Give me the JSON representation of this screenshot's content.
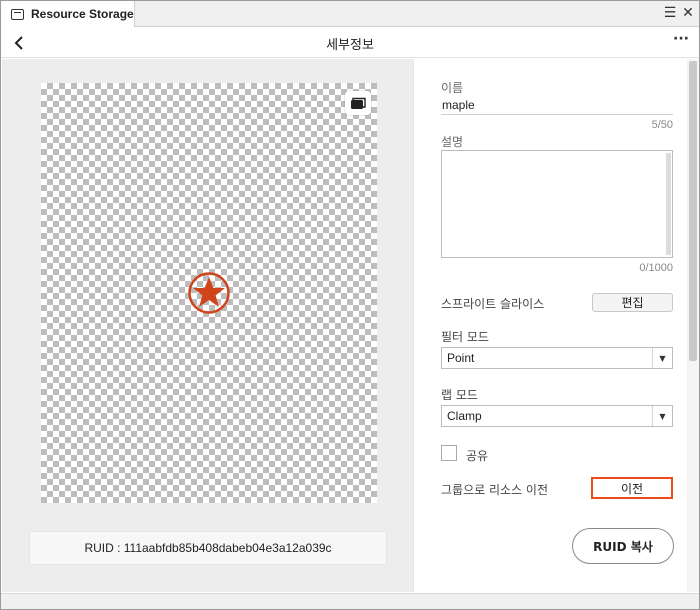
{
  "tab": {
    "label": "Resource Storage"
  },
  "window_controls": {
    "menu": "☰",
    "close": "✕"
  },
  "header": {
    "title": "세부정보",
    "more": "···"
  },
  "preview": {
    "ruid_text": "RUID : 111aabfdb85b408dabeb04e3a12a039c",
    "star_color": "#d0441c"
  },
  "details": {
    "name_label": "이름",
    "name_value": "maple",
    "name_counter": "5/50",
    "desc_label": "설명",
    "desc_counter": "0/1000",
    "sprite_label": "스프라이트 슬라이스",
    "sprite_button": "편집",
    "filter_label": "필터 모드",
    "filter_value": "Point",
    "wrap_label": "랩 모드",
    "wrap_value": "Clamp",
    "share_label": "공유",
    "transfer_label": "그룹으로 리소스 이전",
    "transfer_button": "이전",
    "copy_button": "RUID 복사",
    "accent_color": "#ee4b1c"
  }
}
